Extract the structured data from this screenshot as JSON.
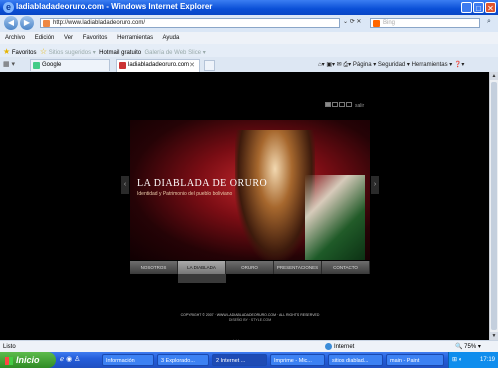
{
  "window": {
    "title": "ladiabladadeoruro.com - Windows Internet Explorer"
  },
  "address": {
    "url": "http://www.ladiabladadeoruro.com/",
    "tools": "⌄ ⟳ ✕",
    "search_placeholder": "Bing"
  },
  "menu": [
    "Archivo",
    "Edición",
    "Ver",
    "Favoritos",
    "Herramientas",
    "Ayuda"
  ],
  "favorites": {
    "label": "Favoritos",
    "items": [
      "Sitios sugeridos ▾",
      "Hotmail gratuito",
      "Galería de Web Slice ▾"
    ]
  },
  "tabs": [
    {
      "label": "Google"
    },
    {
      "label": "ladiabladadeoruro.com"
    }
  ],
  "commandbar": "Página ▾  Seguridad ▾  Herramientas ▾",
  "site": {
    "banner_title": "LA DIABLADA DE ORURO",
    "banner_subtitle": "Identidad y Patrimonio del pueblo boliviano",
    "nav": [
      "NOSOTROS",
      "LA DIABLADA",
      "ORURO",
      "PRESENTACIONES",
      "CONTACTO"
    ],
    "pager_label": "salir",
    "copyright": "COPYRIGHT © 2007 · WWW.LADIABLADADEORURO.COM · ALL RIGHTS RESERVED",
    "credits": "DISEÑO BY · STYLE.COM",
    "partial": "… ·  ·  ·"
  },
  "status": {
    "left": "Listo",
    "zone": "Internet",
    "zoom": "75%"
  },
  "taskbar": {
    "start": "Inicio",
    "items": [
      "Información",
      "3 Explorado...",
      "2 Internet ...",
      "Imprime - Mic...",
      "sitios diablad...",
      "main - Paint"
    ],
    "clock": "17:19"
  }
}
